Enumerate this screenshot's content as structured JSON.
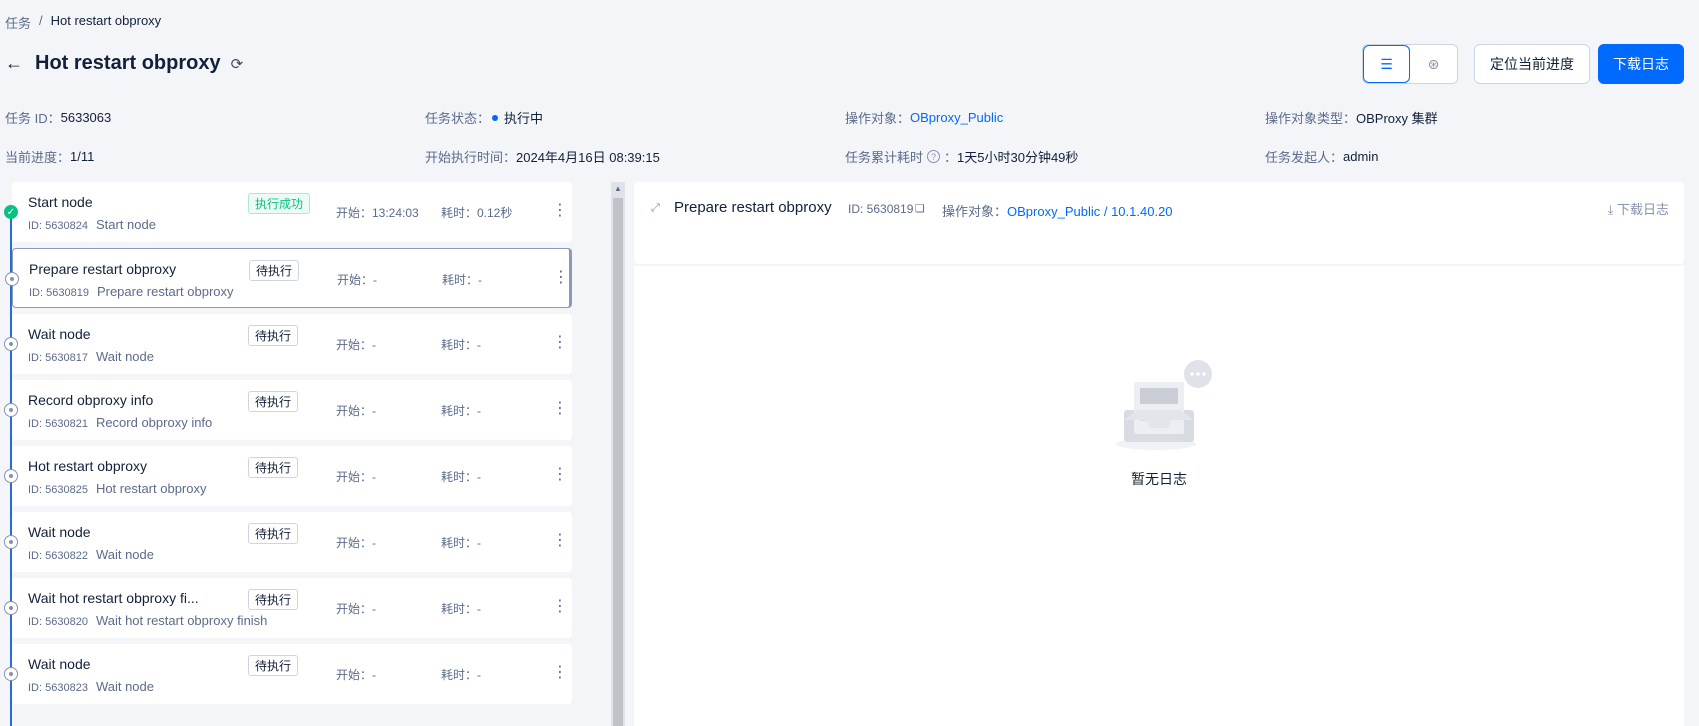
{
  "breadcrumb": {
    "root": "任务",
    "sep": "/",
    "current": "Hot restart obproxy"
  },
  "header": {
    "title": "Hot restart obproxy",
    "locate_label": "定位当前进度",
    "download_label": "下载日志"
  },
  "info": {
    "task_id_label": "任务 ID：",
    "task_id": "5633063",
    "status_label": "任务状态：",
    "status": "执行中",
    "target_label": "操作对象：",
    "target": "OBproxy_Public",
    "target_type_label": "操作对象类型：",
    "target_type": "OBProxy 集群",
    "progress_label": "当前进度：",
    "progress": "1/11",
    "start_label": "开始执行时间：",
    "start": "2024年4月16日 08:39:15",
    "elapsed_label": "任务累计耗时",
    "elapsed": "1天5小时30分钟49秒",
    "initiator_label": "任务发起人：",
    "initiator": "admin"
  },
  "nodes": [
    {
      "name": "Start node",
      "id": "ID: 5630824",
      "desc": "Start node",
      "status": "执行成功",
      "start": "开始：13:24:03",
      "cost": "耗时：0.12秒"
    },
    {
      "name": "Prepare restart obproxy",
      "id": "ID: 5630819",
      "desc": "Prepare restart obproxy",
      "status": "待执行",
      "start": "开始：-",
      "cost": "耗时：-"
    },
    {
      "name": "Wait node",
      "id": "ID: 5630817",
      "desc": "Wait node",
      "status": "待执行",
      "start": "开始：-",
      "cost": "耗时：-"
    },
    {
      "name": "Record obproxy info",
      "id": "ID: 5630821",
      "desc": "Record obproxy info",
      "status": "待执行",
      "start": "开始：-",
      "cost": "耗时：-"
    },
    {
      "name": "Hot restart obproxy",
      "id": "ID: 5630825",
      "desc": "Hot restart obproxy",
      "status": "待执行",
      "start": "开始：-",
      "cost": "耗时：-"
    },
    {
      "name": "Wait node",
      "id": "ID: 5630822",
      "desc": "Wait node",
      "status": "待执行",
      "start": "开始：-",
      "cost": "耗时：-"
    },
    {
      "name": "Wait hot restart obproxy fi...",
      "id": "ID: 5630820",
      "desc": "Wait hot restart obproxy finish",
      "status": "待执行",
      "start": "开始：-",
      "cost": "耗时：-"
    },
    {
      "name": "Wait node",
      "id": "ID: 5630823",
      "desc": "Wait node",
      "status": "待执行",
      "start": "开始：-",
      "cost": "耗时：-"
    }
  ],
  "detail": {
    "title": "Prepare restart obproxy",
    "id": "ID: 5630819",
    "target_label": "操作对象：",
    "target": "OBproxy_Public",
    "target_sep": " / ",
    "target_ip": "10.1.40.20",
    "download_label": "下载日志",
    "empty_text": "暂无日志"
  }
}
